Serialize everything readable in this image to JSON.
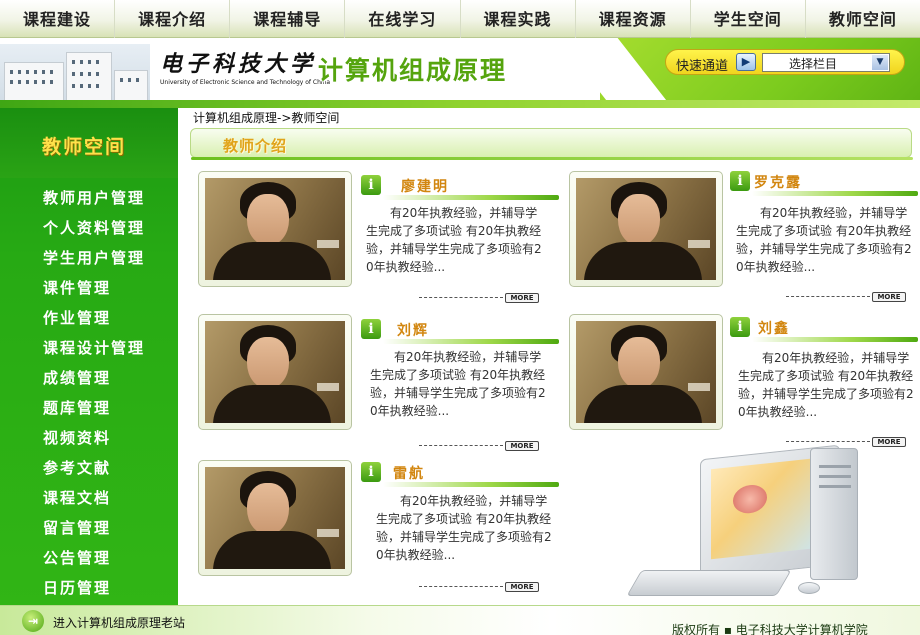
{
  "nav": {
    "items": [
      "课程建设",
      "课程介绍",
      "课程辅导",
      "在线学习",
      "课程实践",
      "课程资源",
      "学生空间",
      "教师空间"
    ]
  },
  "header": {
    "university_cn": "电子科技大学",
    "university_en": "University of Electronic Science and Technology of China",
    "course_title": "计算机组成原理",
    "quick_label": "快速通道",
    "quick_select": "选择栏目"
  },
  "sidebar": {
    "title": "教师空间",
    "items": [
      "教师用户管理",
      "个人资料管理",
      "学生用户管理",
      "课件管理",
      "作业管理",
      "课程设计管理",
      "成绩管理",
      "题库管理",
      "视频资料",
      "参考文献",
      "课程文档",
      "留言管理",
      "公告管理",
      "日历管理"
    ]
  },
  "main": {
    "breadcrumb": "计算机组成原理->教师空间",
    "section_title": "教师介绍",
    "more_label": "MORE",
    "teachers": [
      {
        "name": "廖建明",
        "desc": "有20年执教经验，并辅导学生完成了多项试验    有20年执教经验，并辅导学生完成了多项验有20年执教经验..."
      },
      {
        "name": "罗克露",
        "desc": "有20年执教经验，并辅导学生完成了多项试验    有20年执教经验，并辅导学生完成了多项验有20年执教经验..."
      },
      {
        "name": "刘辉",
        "desc": "有20年执教经验，并辅导学生完成了多项试验    有20年执教经验，并辅导学生完成了多项验有20年执教经验..."
      },
      {
        "name": "刘鑫",
        "desc": "有20年执教经验，并辅导学生完成了多项试验    有20年执教经验，并辅导学生完成了多项验有20年执教经验..."
      },
      {
        "name": "雷航",
        "desc": "有20年执教经验，并辅导学生完成了多项试验    有20年执教经验，并辅导学生完成了多项验有20年执教经验..."
      }
    ]
  },
  "footer": {
    "old_site": "进入计算机组成原理老站",
    "copyright": "版权所有  ▪  电子科技大学计算机学院"
  },
  "colors": {
    "brand_green": "#2aa315",
    "accent_orange": "#d2860f",
    "title_green": "#55a40e",
    "quick_yellow": "#f6e63a"
  },
  "icons": {
    "info": "info-icon",
    "enter": "enter-arrow-icon",
    "dropdown": "chevron-down-icon",
    "go": "play-arrow-icon"
  }
}
